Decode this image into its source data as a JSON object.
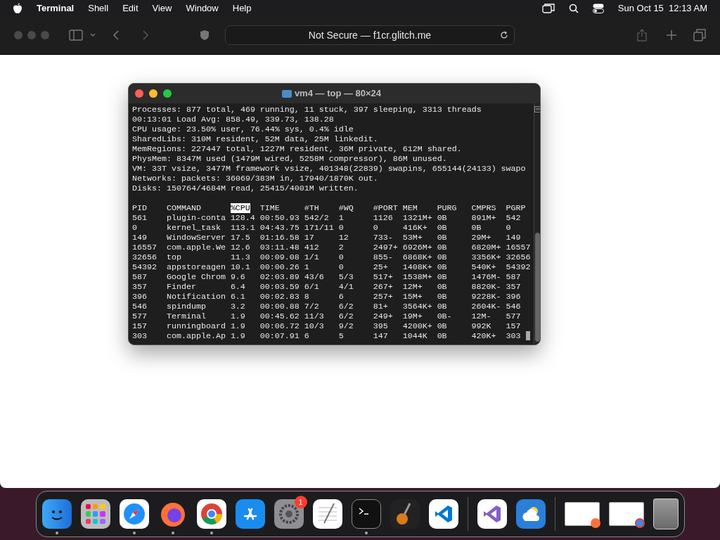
{
  "menubar": {
    "app": "Terminal",
    "menus": [
      "Shell",
      "Edit",
      "View",
      "Window",
      "Help"
    ],
    "clock": "Sun Oct 15  12:13 AM"
  },
  "browser": {
    "address": "Not Secure — f1cr.glitch.me"
  },
  "terminal": {
    "title": "vm4 — top — 80×24",
    "summary": [
      "Processes: 877 total, 469 running, 11 stuck, 397 sleeping, 3313 threads",
      "00:13:01 Load Avg: 858.49, 339.73, 138.28",
      "CPU usage: 23.50% user, 76.44% sys, 0.4% idle",
      "SharedLibs: 310M resident, 52M data, 25M linkedit.",
      "MemRegions: 227447 total, 1227M resident, 36M private, 612M shared.",
      "PhysMem: 8347M used (1479M wired, 5258M compressor), 86M unused.",
      "VM: 33T vsize, 3477M framework vsize, 401348(22839) swapins, 655144(24133) swapo",
      "Networks: packets: 36069/383M in, 17940/1870K out.",
      "Disks: 150764/4684M read, 25415/4001M written."
    ],
    "columns": [
      {
        "label": "PID",
        "sorted": false
      },
      {
        "label": "COMMAND",
        "sorted": false
      },
      {
        "label": "%CPU",
        "sorted": true
      },
      {
        "label": "TIME",
        "sorted": false
      },
      {
        "label": "#TH",
        "sorted": false
      },
      {
        "label": "#WQ",
        "sorted": false
      },
      {
        "label": "#PORT",
        "sorted": false
      },
      {
        "label": "MEM",
        "sorted": false
      },
      {
        "label": "PURG",
        "sorted": false
      },
      {
        "label": "CMPRS",
        "sorted": false
      },
      {
        "label": "PGRP",
        "sorted": false
      }
    ],
    "rows": [
      [
        "561",
        "plugin-conta",
        "128.4",
        "00:50.93",
        "542/2",
        "1",
        "1126",
        "1321M+",
        "0B",
        "891M+",
        "542"
      ],
      [
        "0",
        "kernel_task",
        "113.1",
        "04:43.75",
        "171/11",
        "0",
        "0",
        "416K+",
        "0B",
        "0B",
        "0"
      ],
      [
        "149",
        "WindowServer",
        "17.5",
        "01:16.58",
        "17",
        "12",
        "733-",
        "53M+",
        "0B",
        "29M+",
        "149"
      ],
      [
        "16557",
        "com.apple.We",
        "12.6",
        "03:11.48",
        "412",
        "2",
        "2497+",
        "6926M+",
        "0B",
        "6820M+",
        "16557"
      ],
      [
        "32656",
        "top",
        "11.3",
        "00:09.08",
        "1/1",
        "0",
        "855-",
        "6868K+",
        "0B",
        "3356K+",
        "32656"
      ],
      [
        "54392",
        "appstoreagen",
        "10.1",
        "00:00.26",
        "1",
        "0",
        "25+",
        "1408K+",
        "0B",
        "540K+",
        "54392"
      ],
      [
        "587",
        "Google Chrom",
        "9.6",
        "02:03.89",
        "43/6",
        "5/3",
        "517+",
        "1538M+",
        "0B",
        "1476M-",
        "587"
      ],
      [
        "357",
        "Finder",
        "6.4",
        "00:03.59",
        "6/1",
        "4/1",
        "267+",
        "12M+",
        "0B",
        "8820K-",
        "357"
      ],
      [
        "396",
        "Notification",
        "6.1",
        "00:02.83",
        "8",
        "6",
        "257+",
        "15M+",
        "0B",
        "9228K-",
        "396"
      ],
      [
        "546",
        "spindump",
        "3.2",
        "00:00.88",
        "7/2",
        "6/2",
        "81+",
        "3564K+",
        "0B",
        "2604K-",
        "546"
      ],
      [
        "577",
        "Terminal",
        "1.9",
        "00:45.62",
        "11/3",
        "6/2",
        "249+",
        "19M+",
        "0B-",
        "12M-",
        "577"
      ],
      [
        "157",
        "runningboard",
        "1.9",
        "00:06.72",
        "10/3",
        "9/2",
        "395",
        "4200K+",
        "0B",
        "992K",
        "157"
      ],
      [
        "303",
        "com.apple.Ap",
        "1.9",
        "00:07.91",
        "6",
        "5",
        "147",
        "1044K",
        "0B",
        "420K+",
        "303"
      ]
    ]
  },
  "dock": [
    {
      "kind": "finder",
      "running": true
    },
    {
      "kind": "launchpad",
      "running": false
    },
    {
      "kind": "safari",
      "running": true
    },
    {
      "kind": "firefox",
      "running": true
    },
    {
      "kind": "chrome",
      "running": true
    },
    {
      "kind": "appstore",
      "running": false
    },
    {
      "kind": "settings",
      "running": false,
      "badge": "1"
    },
    {
      "kind": "textedit",
      "running": false
    },
    {
      "kind": "terminal",
      "running": true
    },
    {
      "kind": "garageband",
      "running": false
    },
    {
      "kind": "vscode",
      "running": false
    },
    {
      "kind": "separator"
    },
    {
      "kind": "visualstudio",
      "running": false
    },
    {
      "kind": "weather",
      "running": false
    },
    {
      "kind": "separator"
    },
    {
      "kind": "window-firefox",
      "running": false
    },
    {
      "kind": "window-chrome",
      "running": false
    },
    {
      "kind": "trash",
      "running": false
    }
  ]
}
